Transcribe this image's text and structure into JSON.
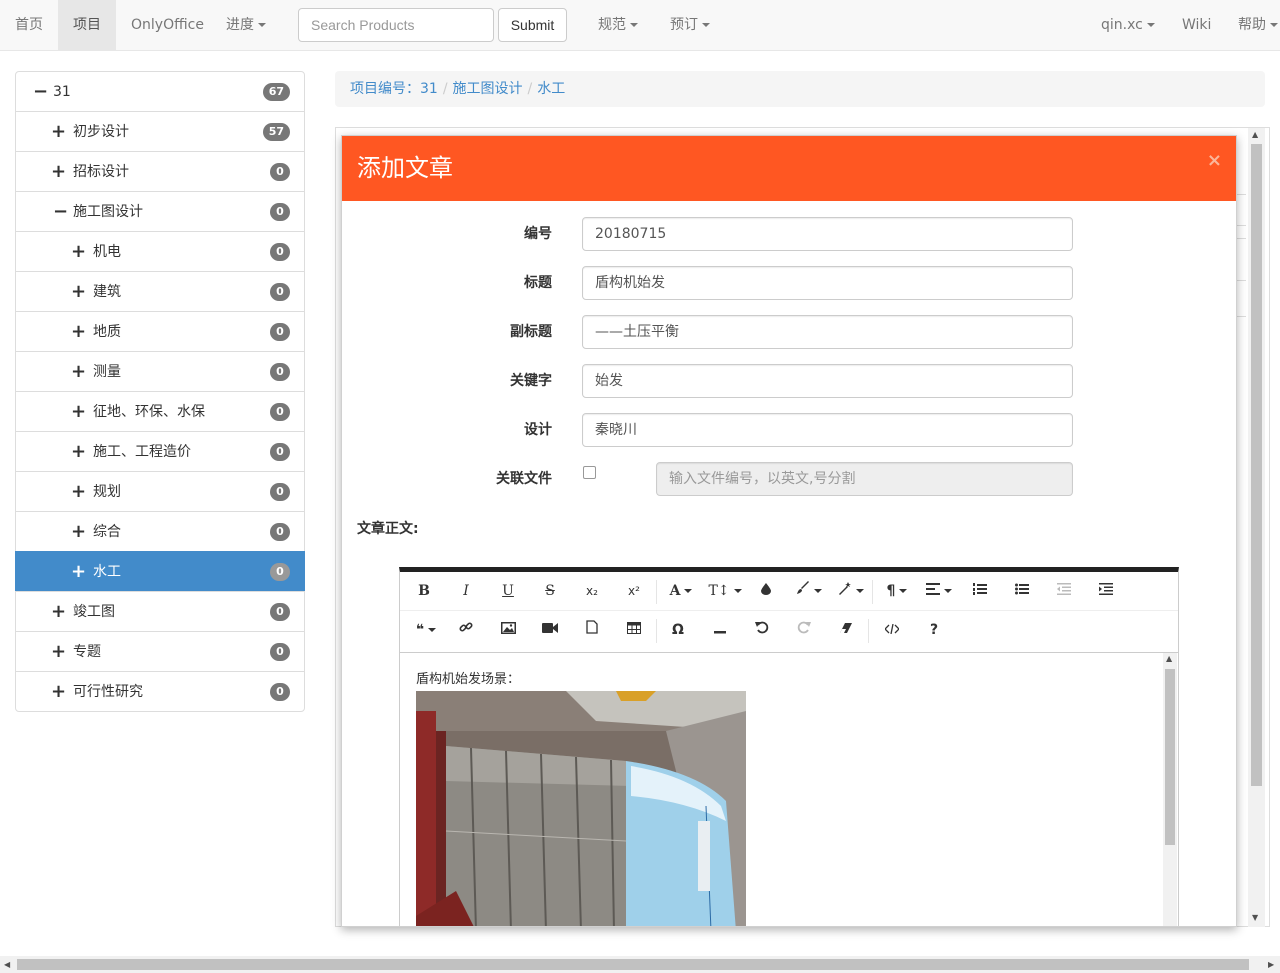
{
  "navbar": {
    "home": "首页",
    "project": "项目",
    "onlyoffice": "OnlyOffice",
    "progress": "进度",
    "search_placeholder": "Search Products",
    "submit": "Submit",
    "standards": "规范",
    "booking": "预订",
    "user": "qin.xc",
    "wiki": "Wiki",
    "help": "帮助"
  },
  "tree": [
    {
      "icon": "−",
      "label": "31",
      "badge": "67"
    },
    {
      "icon": "+",
      "label": "初步设计",
      "badge": "57"
    },
    {
      "icon": "+",
      "label": "招标设计",
      "badge": "0"
    },
    {
      "icon": "−",
      "label": "施工图设计",
      "badge": "0"
    },
    {
      "icon": "+",
      "label": "机电",
      "badge": "0"
    },
    {
      "icon": "+",
      "label": "建筑",
      "badge": "0"
    },
    {
      "icon": "+",
      "label": "地质",
      "badge": "0"
    },
    {
      "icon": "+",
      "label": "测量",
      "badge": "0"
    },
    {
      "icon": "+",
      "label": "征地、环保、水保",
      "badge": "0"
    },
    {
      "icon": "+",
      "label": "施工、工程造价",
      "badge": "0"
    },
    {
      "icon": "+",
      "label": "规划",
      "badge": "0"
    },
    {
      "icon": "+",
      "label": "综合",
      "badge": "0"
    },
    {
      "icon": "+",
      "label": "水工",
      "badge": "0"
    },
    {
      "icon": "+",
      "label": "竣工图",
      "badge": "0"
    },
    {
      "icon": "+",
      "label": "专题",
      "badge": "0"
    },
    {
      "icon": "+",
      "label": "可行性研究",
      "badge": "0"
    }
  ],
  "breadcrumb": {
    "project": "项目编号：31",
    "stage": "施工图设计",
    "current": "水工"
  },
  "modal": {
    "title": "添加文章",
    "close": "×",
    "fields": {
      "number_label": "编号",
      "number_value": "20180715",
      "title_label": "标题",
      "title_value": "盾构机始发",
      "subtitle_label": "副标题",
      "subtitle_value": "——土压平衡",
      "keyword_label": "关键字",
      "keyword_value": "始发",
      "design_label": "设计",
      "design_value": "秦晓川",
      "related_label": "关联文件",
      "related_placeholder": "输入文件编号，以英文,号分割"
    },
    "body_label": "文章正文:",
    "editor": {
      "text": "盾构机始发场景："
    }
  },
  "toolbar": {
    "bold": "B",
    "italic": "I",
    "underline": "U",
    "strike": "S",
    "sub": "x₂",
    "sup": "x²",
    "font": "A",
    "size": "T↕",
    "para": "¶",
    "omega": "Ω",
    "help": "?"
  }
}
